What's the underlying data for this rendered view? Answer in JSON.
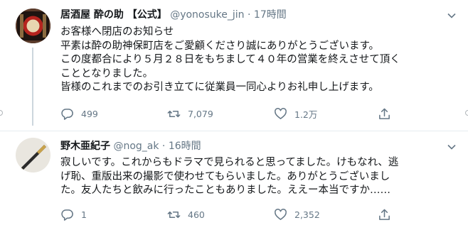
{
  "tweets": [
    {
      "name": "居酒屋 酔の助 【公式】",
      "handle": "@yonosuke_jin",
      "separator": "·",
      "time": "17時間",
      "lines": [
        "お客様へ閉店のお知らせ",
        "平素は酔の助神保町店をご愛顧くださり誠にありがとうございます。",
        "この度都合により５月２８日をもちまして４０年の営業を終えさせて頂く",
        "こととなりました。",
        "皆様のこれまでのお引き立てに従業員一同心よりお礼申し上げます。"
      ],
      "reply_count": "499",
      "retweet_count": "7,079",
      "like_count": "1.2万"
    },
    {
      "name": "野木亜紀子",
      "handle": "@nog_ak",
      "separator": "·",
      "time": "16時間",
      "lines": [
        "寂しいです。これからもドラマで見られると思ってました。けもなれ、逃",
        "げ恥、重版出来の撮影で使わせてもらいました。ありがとうございまし",
        "た。友人たちと飲みに行ったこともありました。ええー本当ですか……"
      ],
      "reply_count": "1",
      "retweet_count": "460",
      "like_count": "2,352"
    }
  ],
  "colors": {
    "text": "#14171a",
    "secondary": "#657786",
    "divider": "#e6ecf0",
    "thread_line": "#ccd6dd"
  },
  "icons": [
    "reply-icon",
    "retweet-icon",
    "like-icon",
    "share-icon",
    "chevron-down-icon"
  ]
}
